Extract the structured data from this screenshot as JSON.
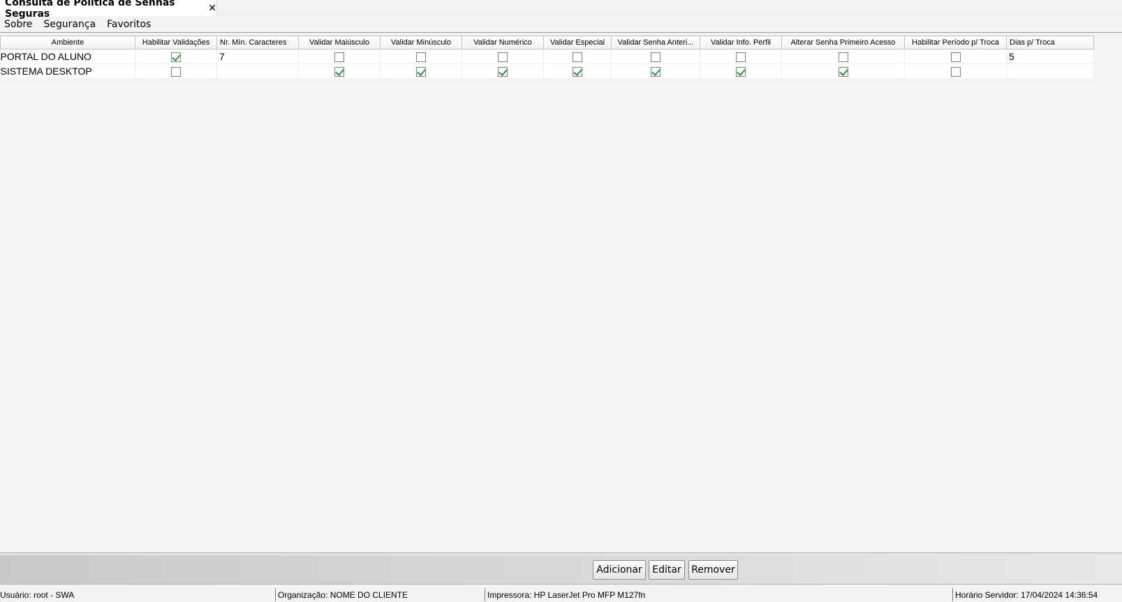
{
  "tab": {
    "title": "Consulta de Política de Senhas Seguras",
    "close_glyph": "✕"
  },
  "menu": [
    {
      "label": "Sobre"
    },
    {
      "label": "Segurança"
    },
    {
      "label": "Favoritos"
    }
  ],
  "table": {
    "columns": [
      "Ambiente",
      "Habilitar Validações",
      "Nr. Mín. Caracteres",
      "Validar Maiúsculo",
      "Validar Minúsculo",
      "Validar Numérico",
      "Validar Especial",
      "Validar Senha Anteri...",
      "Validar Info. Perfil",
      "Alterar Senha Primeiro Acesso",
      "Habilitar Período p/ Troca",
      "Dias p/ Troca"
    ],
    "rows": [
      {
        "ambiente": "PORTAL DO ALUNO",
        "habilitar_validacoes": true,
        "nr_min_caracteres": "7",
        "validar_maiusculo": false,
        "validar_minusculo": false,
        "validar_numerico": false,
        "validar_especial": false,
        "validar_senha_anterior": false,
        "validar_info_perfil": false,
        "alterar_senha_primeiro_acesso": false,
        "habilitar_periodo_troca": false,
        "dias_troca": "5"
      },
      {
        "ambiente": "SISTEMA DESKTOP",
        "habilitar_validacoes": false,
        "nr_min_caracteres": "",
        "validar_maiusculo": true,
        "validar_minusculo": true,
        "validar_numerico": true,
        "validar_especial": true,
        "validar_senha_anterior": true,
        "validar_info_perfil": true,
        "alterar_senha_primeiro_acesso": true,
        "habilitar_periodo_troca": false,
        "dias_troca": ""
      }
    ]
  },
  "buttons": {
    "add": "Adicionar",
    "edit": "Editar",
    "remove": "Remover"
  },
  "status": {
    "user": "Usuário: root - SWA",
    "organization": "Organização: NOME DO CLIENTE",
    "printer": "Impressora: HP LaserJet Pro MFP M127fn",
    "server_time": "Horário Servidor: 17/04/2024 14:36:54"
  },
  "colors": {
    "check_green": "#1e9b3a",
    "background": "#f3f3f3"
  }
}
